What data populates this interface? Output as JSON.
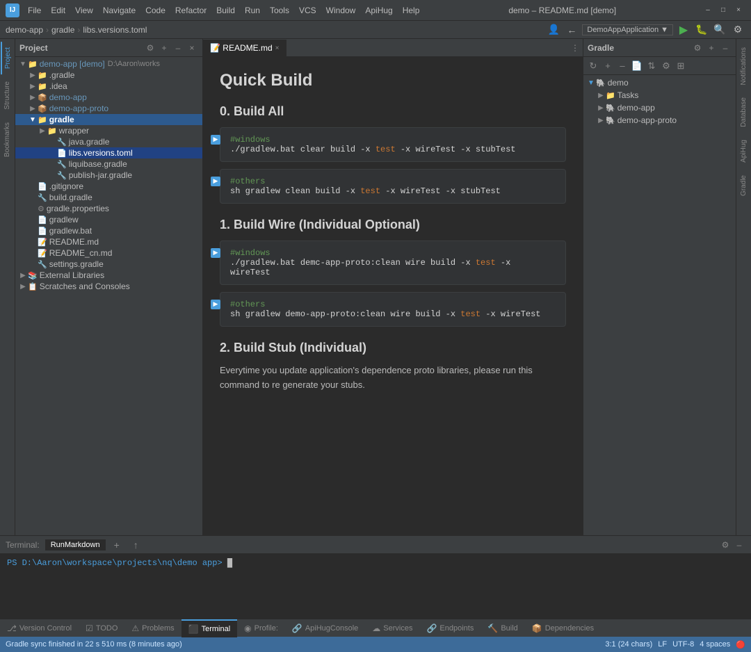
{
  "titlebar": {
    "app_name": "IJ",
    "menu_items": [
      "File",
      "Edit",
      "View",
      "Navigate",
      "Code",
      "Refactor",
      "Build",
      "Run",
      "Tools",
      "VCS",
      "Window",
      "ApiHug",
      "Help"
    ],
    "window_title": "demo – README.md [demo]",
    "run_config": "DemoAppApplication",
    "controls": [
      "–",
      "□",
      "×"
    ]
  },
  "breadcrumb": {
    "items": [
      "demo-app",
      "gradle",
      "libs.versions.toml"
    ]
  },
  "project_panel": {
    "title": "Project",
    "tree": [
      {
        "id": "demo-app",
        "label": "demo-app [demo]",
        "indent": 0,
        "type": "module",
        "arrow": "▼"
      },
      {
        "id": "gradle-dir",
        "label": ".gradle",
        "indent": 1,
        "type": "folder-yellow",
        "arrow": "▶"
      },
      {
        "id": "idea-dir",
        "label": ".idea",
        "indent": 1,
        "type": "folder-yellow",
        "arrow": "▶"
      },
      {
        "id": "demo-app-dir",
        "label": "demo-app",
        "indent": 1,
        "type": "module",
        "arrow": "▶"
      },
      {
        "id": "demo-app-proto-dir",
        "label": "demo-app-proto",
        "indent": 1,
        "type": "module",
        "arrow": "▶"
      },
      {
        "id": "gradle-folder",
        "label": "gradle",
        "indent": 1,
        "type": "folder-yellow",
        "arrow": "▼",
        "selected": true
      },
      {
        "id": "wrapper",
        "label": "wrapper",
        "indent": 2,
        "type": "folder-yellow",
        "arrow": "▶"
      },
      {
        "id": "java-gradle",
        "label": "java.gradle",
        "indent": 2,
        "type": "gradle",
        "arrow": ""
      },
      {
        "id": "libs-versions",
        "label": "libs.versions.toml",
        "indent": 2,
        "type": "toml",
        "arrow": "",
        "selected": true
      },
      {
        "id": "liquibase-gradle",
        "label": "liquibase.gradle",
        "indent": 2,
        "type": "gradle",
        "arrow": ""
      },
      {
        "id": "publish-jar-gradle",
        "label": "publish-jar.gradle",
        "indent": 2,
        "type": "gradle",
        "arrow": ""
      },
      {
        "id": "gitignore",
        "label": ".gitignore",
        "indent": 1,
        "type": "file",
        "arrow": ""
      },
      {
        "id": "build-gradle",
        "label": "build.gradle",
        "indent": 1,
        "type": "gradle",
        "arrow": ""
      },
      {
        "id": "gradle-properties",
        "label": "gradle.properties",
        "indent": 1,
        "type": "properties",
        "arrow": ""
      },
      {
        "id": "gradlew",
        "label": "gradlew",
        "indent": 1,
        "type": "file",
        "arrow": ""
      },
      {
        "id": "gradlew-bat",
        "label": "gradlew.bat",
        "indent": 1,
        "type": "bat",
        "arrow": ""
      },
      {
        "id": "readme-md",
        "label": "README.md",
        "indent": 1,
        "type": "md",
        "arrow": ""
      },
      {
        "id": "readme-cn",
        "label": "README_cn.md",
        "indent": 1,
        "type": "md",
        "arrow": ""
      },
      {
        "id": "settings-gradle",
        "label": "settings.gradle",
        "indent": 1,
        "type": "gradle",
        "arrow": ""
      },
      {
        "id": "external-libraries",
        "label": "External Libraries",
        "indent": 0,
        "type": "library",
        "arrow": "▶"
      },
      {
        "id": "scratches",
        "label": "Scratches and Consoles",
        "indent": 0,
        "type": "scratch",
        "arrow": "▶"
      }
    ]
  },
  "editor": {
    "tabs": [
      {
        "id": "readme",
        "label": "README.md",
        "active": true
      }
    ],
    "content": {
      "title": "Quick Build",
      "sections": [
        {
          "id": "build-all",
          "heading": "0. Build All",
          "blocks": [
            {
              "id": "windows-block1",
              "comment": "#windows",
              "command": "./gradlew.bat clear build -x test -x wireTest -x stubTest"
            },
            {
              "id": "others-block1",
              "comment": "#others",
              "command": "sh gradlew clean build -x test -x wireTest -x stubTest"
            }
          ]
        },
        {
          "id": "build-wire",
          "heading": "1. Build Wire (Individual Optional)",
          "blocks": [
            {
              "id": "windows-block2",
              "comment": "#windows",
              "command": "./gradlew.bat demc-app-proto:clean wire build -x test -x wireTest"
            },
            {
              "id": "others-block2",
              "comment": "#others",
              "command": "sh gradlew demo-app-proto:clean wire build -x test -x wireTest"
            }
          ]
        },
        {
          "id": "build-stub",
          "heading": "2. Build Stub (Individual)",
          "description": "Everytime you update application's dependence proto libraries, please run this command to re generate your stubs."
        }
      ]
    }
  },
  "gradle_panel": {
    "title": "Gradle",
    "tree": [
      {
        "id": "demo",
        "label": "demo",
        "indent": 0,
        "arrow": "▼"
      },
      {
        "id": "tasks",
        "label": "Tasks",
        "indent": 1,
        "arrow": "▶"
      },
      {
        "id": "demo-app",
        "label": "demo-app",
        "indent": 1,
        "arrow": "▶"
      },
      {
        "id": "demo-app-proto",
        "label": "demo-app-proto",
        "indent": 1,
        "arrow": "▶"
      }
    ]
  },
  "terminal": {
    "label": "Terminal:",
    "tabs": [
      "RunMarkdown"
    ],
    "prompt": "PS D:\\Aaron\\workspace\\projects\\nq\\demo app>",
    "cursor": "█"
  },
  "bottom_tabs": [
    {
      "id": "version-control",
      "label": "Version Control",
      "icon": "⎇",
      "active": false
    },
    {
      "id": "todo",
      "label": "TODO",
      "icon": "☑",
      "active": false
    },
    {
      "id": "problems",
      "label": "Problems",
      "icon": "⚠",
      "active": false
    },
    {
      "id": "terminal",
      "label": "Terminal",
      "icon": "⬛",
      "active": true
    },
    {
      "id": "profile",
      "label": "Profile:",
      "icon": "◉",
      "active": false
    },
    {
      "id": "apihug-console",
      "label": "ApiHugConsole",
      "icon": "🔗",
      "active": false
    },
    {
      "id": "services",
      "label": "Services",
      "icon": "☁",
      "active": false
    },
    {
      "id": "endpoints",
      "label": "Endpoints",
      "icon": "🔗",
      "active": false
    },
    {
      "id": "build",
      "label": "Build",
      "icon": "🔨",
      "active": false
    },
    {
      "id": "dependencies",
      "label": "Dependencies",
      "icon": "📦",
      "active": false
    }
  ],
  "statusbar": {
    "message": "Gradle sync finished in 22 s 510 ms (8 minutes ago)",
    "position": "3:1 (24 chars)",
    "line_ending": "LF",
    "encoding": "UTF-8",
    "indent": "4 spaces",
    "error_icon": "🔴"
  },
  "right_side_tabs": [
    "Notifications",
    "Database",
    "ApiHug",
    "Gradle"
  ],
  "left_side_tabs": [
    "Project",
    "Structure",
    "Bookmarks"
  ]
}
